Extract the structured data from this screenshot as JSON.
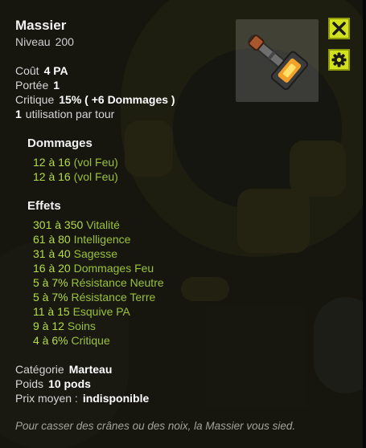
{
  "item": {
    "name": "Massier",
    "level_label": "Niveau",
    "level_value": "200",
    "icon": "hammer-mallet-icon"
  },
  "stats": [
    {
      "label": "Coût",
      "value": "4 PA"
    },
    {
      "label": "Portée",
      "value": "1"
    },
    {
      "label": "Critique",
      "value": "15% ( +6 Dommages )"
    },
    {
      "label": "utilisation par tour",
      "value": "1"
    }
  ],
  "damages": {
    "title": "Dommages",
    "lines": [
      {
        "range": "12 à 16",
        "text": "(vol Feu)"
      },
      {
        "range": "12 à 16",
        "text": "(vol Feu)"
      }
    ]
  },
  "effects": {
    "title": "Effets",
    "lines": [
      {
        "range": "301 à 350",
        "text": "Vitalité"
      },
      {
        "range": "61 à 80",
        "text": "Intelligence"
      },
      {
        "range": "31 à 40",
        "text": "Sagesse"
      },
      {
        "range": "16 à 20",
        "text": "Dommages Feu"
      },
      {
        "range": "5 à 7%",
        "text": "Résistance Neutre"
      },
      {
        "range": "5 à 7%",
        "text": "Résistance Terre"
      },
      {
        "range": "11 à 15",
        "text": "Esquive PA"
      },
      {
        "range": "9 à 12",
        "text": "Soins"
      },
      {
        "range": "4 à 6%",
        "text": "Critique"
      }
    ]
  },
  "info": [
    {
      "label": "Catégorie",
      "value": "Marteau"
    },
    {
      "label": "Poids",
      "value": "10 pods"
    },
    {
      "label": "Prix moyen :",
      "value": "indisponible"
    }
  ],
  "description": "Pour casser des crânes ou des noix, la Massier vous sied.",
  "buttons": {
    "close": "close-icon",
    "settings": "gear-icon"
  },
  "colors": {
    "accent": "#d3e21f",
    "positive": "#9ac13a",
    "panel": "#1a1912"
  }
}
